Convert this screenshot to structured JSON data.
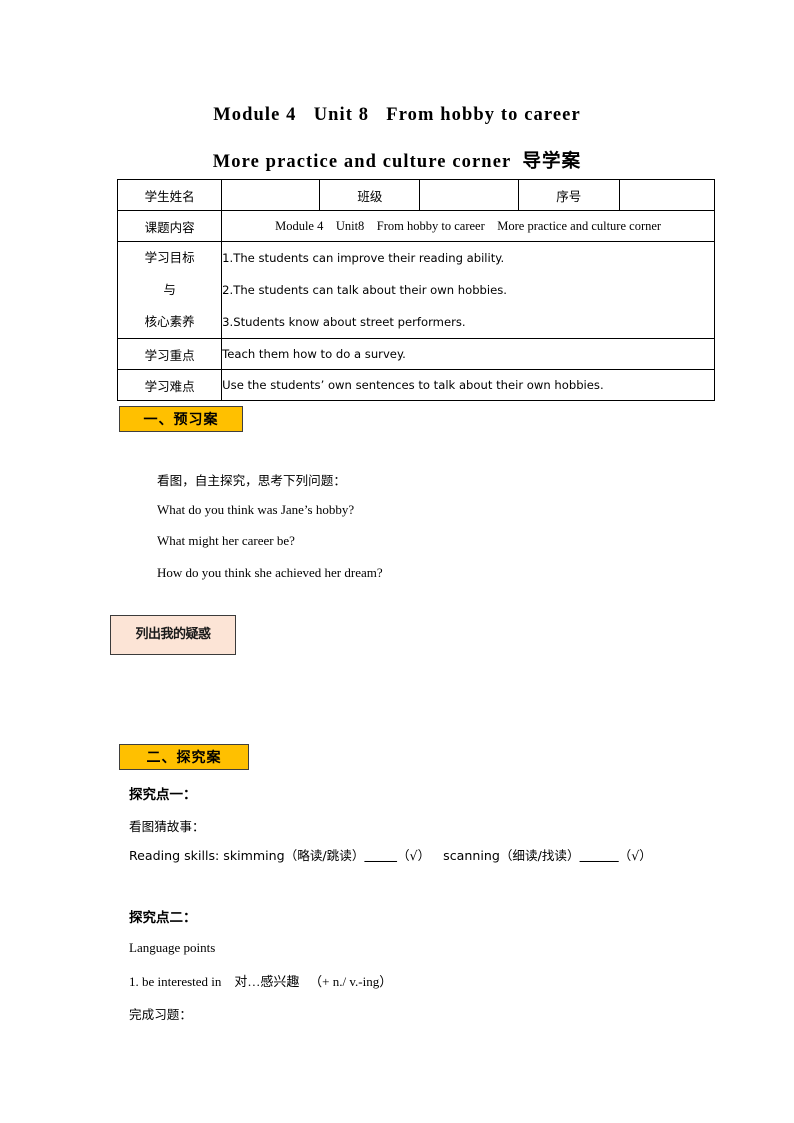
{
  "document": {
    "title_line_1": "Module 4   Unit 8   From hobby to career",
    "title_line_2": "More practice and culture corner  导学案"
  },
  "info_table": {
    "row_student": {
      "label_name": "学生姓名",
      "value_name": "",
      "label_class": "班级",
      "value_class": "",
      "label_number": "序号",
      "value_number": ""
    },
    "row_topic": {
      "label": "课题内容",
      "value": "Module 4    Unit8    From hobby to career    More practice and culture corner"
    },
    "row_goals": {
      "label_line_1": "学习目标",
      "label_line_2": "与",
      "label_line_3": "核心素养",
      "items": [
        "1.The students can improve their reading ability.",
        "2.The students can talk about their own hobbies.",
        "3.Students know about street performers."
      ]
    },
    "row_key_point": {
      "label": "学习重点",
      "value": "Teach them how to do a survey."
    },
    "row_difficulty": {
      "label": "学习难点",
      "value": "Use the students’ own sentences to talk about their own hobbies."
    }
  },
  "section_preview": {
    "tag": "一、预习案",
    "instruction": "看图，自主探究，思考下列问题：",
    "questions": [
      "What do you think was Jane’s hobby?",
      "What might her career be?",
      "How do you think she achieved her dream?"
    ],
    "doubt_box": "列出我的疑惑"
  },
  "section_inquiry": {
    "tag": "二、探究案",
    "point_one": {
      "heading": "探究点一：",
      "subheading": "看图猜故事：",
      "reading_skills_prefix": "Reading skills: skimming（略读/跳读）",
      "reading_skills_blank_1": "_____",
      "reading_skills_check_1": "（√）",
      "reading_skills_mid": "scanning（细读/找读）",
      "reading_skills_blank_2": "______",
      "reading_skills_check_2": "（√）"
    },
    "point_two": {
      "heading": "探究点二：",
      "subheading": "Language points",
      "item_1": "1. be interested in    对…感兴趣   （+ n./ v.-ing）",
      "exercise_prompt": "完成习题："
    }
  },
  "colors": {
    "section_tag_bg": "#FFC000",
    "section_tag_border": "#3F3F3F",
    "doubt_box_bg": "#FCE4D6",
    "doubt_box_border": "#3B3B3B",
    "table_border": "#000000",
    "text": "#000000"
  }
}
